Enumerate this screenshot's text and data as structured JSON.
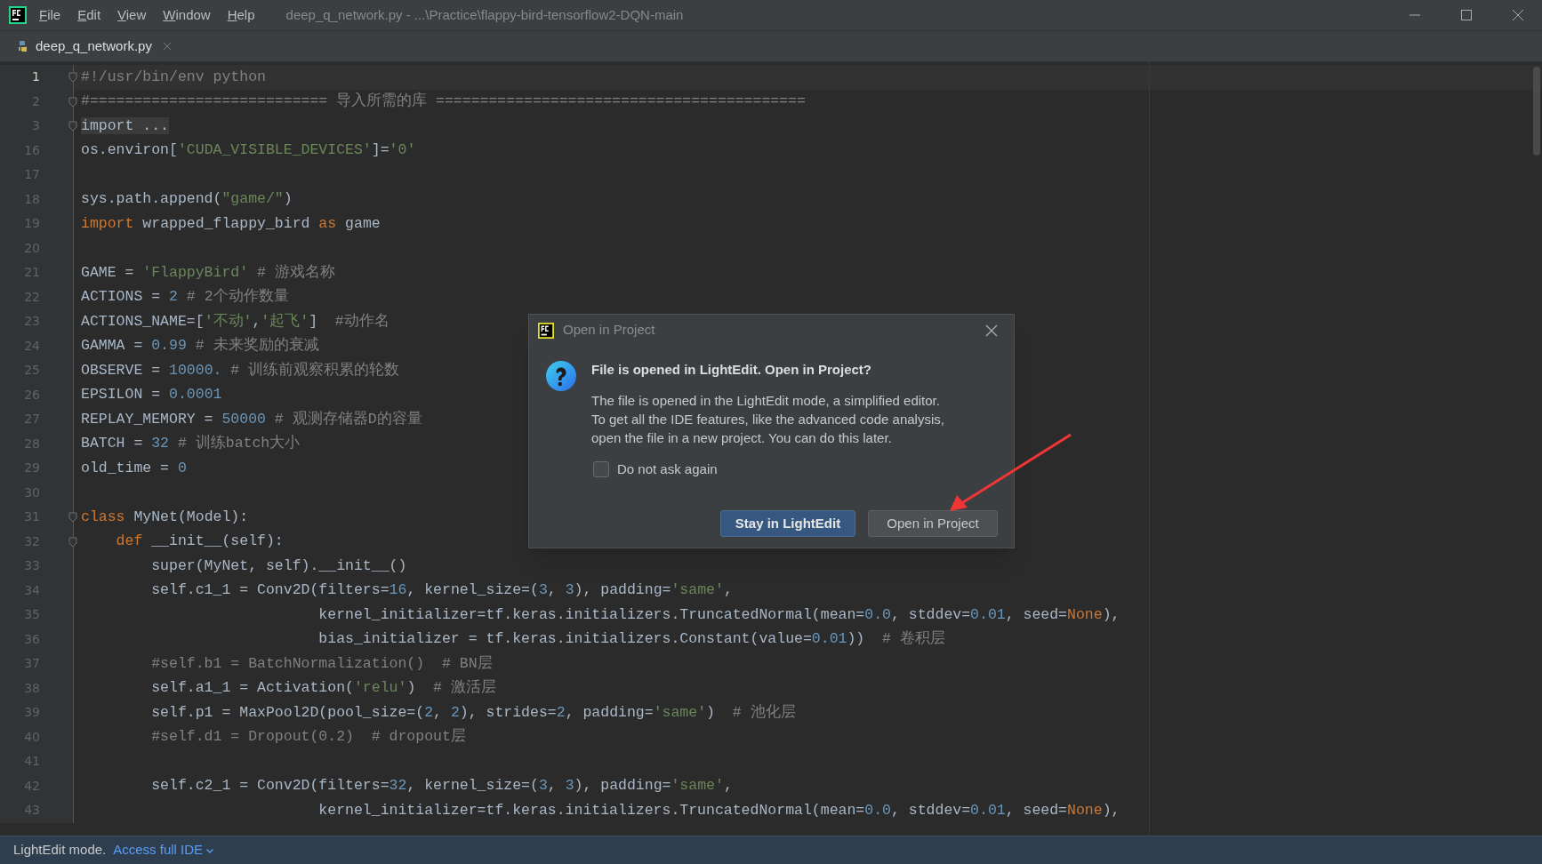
{
  "window": {
    "title": "deep_q_network.py - ...\\Practice\\flappy-bird-tensorflow2-DQN-main"
  },
  "menu": [
    "File",
    "Edit",
    "View",
    "Window",
    "Help"
  ],
  "tabs": [
    {
      "label": "deep_q_network.py",
      "selected": true
    }
  ],
  "editor": {
    "lines": [
      {
        "number": "1",
        "current": true,
        "fold": true,
        "tokens": [
          {
            "kind": "comment",
            "text": "#!/usr/bin/env python"
          }
        ]
      },
      {
        "number": "2",
        "current": false,
        "fold": true,
        "tokens": [
          {
            "kind": "comment",
            "text": "#=========================== 导入所需的库 =========================================="
          }
        ]
      },
      {
        "number": "3",
        "current": false,
        "fold": true,
        "tokens": [
          {
            "kind": "folded",
            "text": "import ..."
          }
        ]
      },
      {
        "number": "16",
        "current": false,
        "tokens": [
          {
            "kind": "plain",
            "text": "os.environ["
          },
          {
            "kind": "string",
            "text": "'CUDA_VISIBLE_DEVICES'"
          },
          {
            "kind": "plain",
            "text": "]="
          },
          {
            "kind": "string",
            "text": "'0'"
          }
        ]
      },
      {
        "number": "17",
        "current": false
      },
      {
        "number": "18",
        "current": false,
        "tokens": [
          {
            "kind": "plain",
            "text": "sys.path.append("
          },
          {
            "kind": "string",
            "text": "\"game/\""
          },
          {
            "kind": "plain",
            "text": ")"
          }
        ]
      },
      {
        "number": "19",
        "current": false,
        "tokens": [
          {
            "kind": "keyword",
            "text": "import"
          },
          {
            "kind": "plain",
            "text": " wrapped_flappy_bird "
          },
          {
            "kind": "keyword",
            "text": "as"
          },
          {
            "kind": "plain",
            "text": " game"
          }
        ]
      },
      {
        "number": "20",
        "current": false
      },
      {
        "number": "21",
        "current": false,
        "tokens": [
          {
            "kind": "plain",
            "text": "GAME = "
          },
          {
            "kind": "string",
            "text": "'FlappyBird'"
          },
          {
            "kind": "comment",
            "text": " # 游戏名称"
          }
        ]
      },
      {
        "number": "22",
        "current": false,
        "tokens": [
          {
            "kind": "plain",
            "text": "ACTIONS = "
          },
          {
            "kind": "number",
            "text": "2"
          },
          {
            "kind": "comment",
            "text": " # 2个动作数量"
          }
        ]
      },
      {
        "number": "23",
        "current": false,
        "tokens": [
          {
            "kind": "plain",
            "text": "ACTIONS_NAME=["
          },
          {
            "kind": "string",
            "text": "'不动'"
          },
          {
            "kind": "plain",
            "text": ","
          },
          {
            "kind": "string",
            "text": "'起飞'"
          },
          {
            "kind": "plain",
            "text": "]"
          },
          {
            "kind": "comment",
            "text": "  #动作名"
          }
        ]
      },
      {
        "number": "24",
        "current": false,
        "tokens": [
          {
            "kind": "plain",
            "text": "GAMMA = "
          },
          {
            "kind": "number",
            "text": "0.99"
          },
          {
            "kind": "comment",
            "text": " # 未来奖励的衰减"
          }
        ]
      },
      {
        "number": "25",
        "current": false,
        "tokens": [
          {
            "kind": "plain",
            "text": "OBSERVE = "
          },
          {
            "kind": "number",
            "text": "10000."
          },
          {
            "kind": "comment",
            "text": " # 训练前观察积累的轮数"
          }
        ]
      },
      {
        "number": "26",
        "current": false,
        "tokens": [
          {
            "kind": "plain",
            "text": "EPSILON = "
          },
          {
            "kind": "number",
            "text": "0.0001"
          }
        ]
      },
      {
        "number": "27",
        "current": false,
        "tokens": [
          {
            "kind": "plain",
            "text": "REPLAY_MEMORY = "
          },
          {
            "kind": "number",
            "text": "50000"
          },
          {
            "kind": "comment",
            "text": " # 观测存储器D的容量"
          }
        ]
      },
      {
        "number": "28",
        "current": false,
        "tokens": [
          {
            "kind": "plain",
            "text": "BATCH = "
          },
          {
            "kind": "number",
            "text": "32"
          },
          {
            "kind": "comment",
            "text": " # 训练batch大小"
          }
        ]
      },
      {
        "number": "29",
        "current": false,
        "tokens": [
          {
            "kind": "plain",
            "text": "old_time = "
          },
          {
            "kind": "number",
            "text": "0"
          }
        ]
      },
      {
        "number": "30",
        "current": false
      },
      {
        "number": "31",
        "current": false,
        "fold": true,
        "tokens": [
          {
            "kind": "keyword",
            "text": "class"
          },
          {
            "kind": "plain",
            "text": " MyNet(Model):"
          }
        ]
      },
      {
        "number": "32",
        "current": false,
        "fold": true,
        "tokens": [
          {
            "kind": "keyword",
            "text": "    def"
          },
          {
            "kind": "plain",
            "text": " __init__(self):"
          }
        ]
      },
      {
        "number": "33",
        "current": false,
        "tokens": [
          {
            "kind": "plain",
            "text": "        super(MyNet, self).__init__()"
          }
        ]
      },
      {
        "number": "34",
        "current": false,
        "tokens": [
          {
            "kind": "plain",
            "text": "        self.c1_1 = Conv2D(filters="
          },
          {
            "kind": "number",
            "text": "16"
          },
          {
            "kind": "plain",
            "text": ", kernel_size=("
          },
          {
            "kind": "number",
            "text": "3"
          },
          {
            "kind": "plain",
            "text": ", "
          },
          {
            "kind": "number",
            "text": "3"
          },
          {
            "kind": "plain",
            "text": "), padding="
          },
          {
            "kind": "string",
            "text": "'same'"
          },
          {
            "kind": "plain",
            "text": ","
          }
        ]
      },
      {
        "number": "35",
        "current": false,
        "tokens": [
          {
            "kind": "plain",
            "text": "                           kernel_initializer=tf.keras.initializers.TruncatedNormal(mean="
          },
          {
            "kind": "number",
            "text": "0.0"
          },
          {
            "kind": "plain",
            "text": ", stddev="
          },
          {
            "kind": "number",
            "text": "0.01"
          },
          {
            "kind": "plain",
            "text": ", seed="
          },
          {
            "kind": "keyword",
            "text": "None"
          },
          {
            "kind": "plain",
            "text": "),"
          }
        ]
      },
      {
        "number": "36",
        "current": false,
        "tokens": [
          {
            "kind": "plain",
            "text": "                           bias_initializer = tf.keras.initializers.Constant(value="
          },
          {
            "kind": "number",
            "text": "0.01"
          },
          {
            "kind": "plain",
            "text": "))"
          },
          {
            "kind": "comment",
            "text": "  # 卷积层"
          }
        ]
      },
      {
        "number": "37",
        "current": false,
        "tokens": [
          {
            "kind": "comment",
            "text": "        #self.b1 = BatchNormalization()  # BN层"
          }
        ]
      },
      {
        "number": "38",
        "current": false,
        "tokens": [
          {
            "kind": "plain",
            "text": "        self.a1_1 = Activation("
          },
          {
            "kind": "string",
            "text": "'relu'"
          },
          {
            "kind": "plain",
            "text": ")"
          },
          {
            "kind": "comment",
            "text": "  # 激活层"
          }
        ]
      },
      {
        "number": "39",
        "current": false,
        "tokens": [
          {
            "kind": "plain",
            "text": "        self.p1 = MaxPool2D(pool_size=("
          },
          {
            "kind": "number",
            "text": "2"
          },
          {
            "kind": "plain",
            "text": ", "
          },
          {
            "kind": "number",
            "text": "2"
          },
          {
            "kind": "plain",
            "text": "), strides="
          },
          {
            "kind": "number",
            "text": "2"
          },
          {
            "kind": "plain",
            "text": ", padding="
          },
          {
            "kind": "string",
            "text": "'same'"
          },
          {
            "kind": "plain",
            "text": ")"
          },
          {
            "kind": "comment",
            "text": "  # 池化层"
          }
        ]
      },
      {
        "number": "40",
        "current": false,
        "tokens": [
          {
            "kind": "comment",
            "text": "        #self.d1 = Dropout(0.2)  # dropout层"
          }
        ]
      },
      {
        "number": "41",
        "current": false
      },
      {
        "number": "42",
        "current": false,
        "tokens": [
          {
            "kind": "plain",
            "text": "        self.c2_1 = Conv2D(filters="
          },
          {
            "kind": "number",
            "text": "32"
          },
          {
            "kind": "plain",
            "text": ", kernel_size=("
          },
          {
            "kind": "number",
            "text": "3"
          },
          {
            "kind": "plain",
            "text": ", "
          },
          {
            "kind": "number",
            "text": "3"
          },
          {
            "kind": "plain",
            "text": "), padding="
          },
          {
            "kind": "string",
            "text": "'same'"
          },
          {
            "kind": "plain",
            "text": ","
          }
        ]
      },
      {
        "number": "43",
        "current": false,
        "tokens": [
          {
            "kind": "plain",
            "text": "                           kernel_initializer=tf.keras.initializers.TruncatedNormal(mean="
          },
          {
            "kind": "number",
            "text": "0.0"
          },
          {
            "kind": "plain",
            "text": ", stddev="
          },
          {
            "kind": "number",
            "text": "0.01"
          },
          {
            "kind": "plain",
            "text": ", seed="
          },
          {
            "kind": "keyword",
            "text": "None"
          },
          {
            "kind": "plain",
            "text": "),"
          }
        ]
      }
    ]
  },
  "dialog": {
    "title": "Open in Project",
    "heading": "File is opened in LightEdit. Open in Project?",
    "body": [
      "The file is opened in the LightEdit mode, a simplified editor.",
      "To get all the IDE features, like the advanced code analysis,",
      "open the file in a new project. You can do this later."
    ],
    "checkbox": {
      "label": "Do not ask again",
      "checked": false
    },
    "buttons": [
      {
        "label": "Stay in LightEdit",
        "primary": true
      },
      {
        "label": "Open in Project",
        "primary": false
      }
    ]
  },
  "status_bar": {
    "mode": "LightEdit mode.",
    "link": "Access full IDE"
  }
}
